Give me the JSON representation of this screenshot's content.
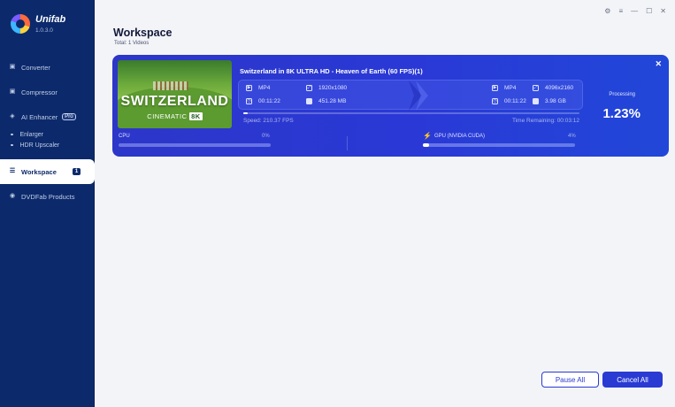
{
  "app": {
    "name": "Unifab",
    "version": "1.0.3.0"
  },
  "sidebar": {
    "items": [
      {
        "label": "Converter",
        "icon": "converter-icon"
      },
      {
        "label": "Compressor",
        "icon": "compressor-icon"
      },
      {
        "label": "AI Enhancer",
        "icon": "ai-enhancer-icon",
        "badge": "Pro"
      },
      {
        "label": "Enlarger"
      },
      {
        "label": "HDR Upscaler"
      },
      {
        "label": "Workspace",
        "icon": "workspace-icon",
        "badge": "1",
        "active": true
      },
      {
        "label": "DVDFab Products",
        "icon": "dvdfab-products-icon"
      }
    ]
  },
  "window_controls": [
    "settings-icon",
    "menu-icon",
    "minimize-icon",
    "maximize-icon",
    "close-icon"
  ],
  "workspace": {
    "title": "Workspace",
    "subtitle": "Total: 1 Videos"
  },
  "task": {
    "thumbnail_title": "SWITZERLAND",
    "thumbnail_subtitle": "CINEMATIC",
    "thumbnail_badge": "8K",
    "title": "Switzerland in 8K ULTRA HD - Heaven of Earth (60 FPS)(1)",
    "source": {
      "format": "MP4",
      "resolution": "1920x1080",
      "duration": "00:11:22",
      "size": "451.28 MB"
    },
    "output": {
      "format": "MP4",
      "resolution": "4096x2160",
      "duration": "00:11:22",
      "size": "3.98 GB"
    },
    "speed": "Speed: 210.37 FPS",
    "time_remaining": "Time Remaining: 00:03:12",
    "status_label": "Processing",
    "progress_text": "1.23%",
    "progress_fraction": 0.0123,
    "cpu_label": "CPU",
    "cpu_pct": "0%",
    "cpu_fraction": 0.0,
    "gpu_label": "GPU (NVIDIA CUDA)",
    "gpu_pct": "4%",
    "gpu_fraction": 0.04
  },
  "buttons": {
    "pause_all": "Pause All",
    "cancel_all": "Cancel All"
  },
  "colors": {
    "sidebar_bg": "#0c2a6b",
    "card_accent": "#2a3bd3",
    "page_bg": "#f3f4f8"
  }
}
